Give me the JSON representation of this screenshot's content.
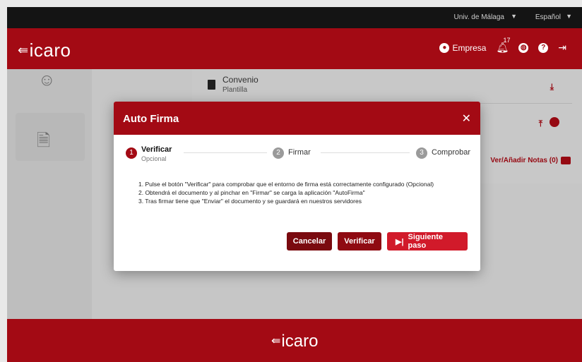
{
  "topbar": {
    "university": "Univ. de Málaga",
    "language": "Español"
  },
  "header": {
    "logo": "icaro",
    "empresa_label": "Empresa",
    "notifications_count": "17"
  },
  "panel": {
    "doc_title": "Convenio",
    "doc_subtitle": "Plantilla",
    "notes_label": "Ver/Añadir Notas (0)"
  },
  "modal": {
    "title": "Auto Firma",
    "steps": [
      {
        "num": "1",
        "label": "Verificar",
        "sub": "Opcional"
      },
      {
        "num": "2",
        "label": "Firmar"
      },
      {
        "num": "3",
        "label": "Comprobar"
      }
    ],
    "instructions": [
      "1. Pulse el botón \"Verificar\" para comprobar que el entorno de firma está correctamente configurado (Opcional)",
      "2. Obtendrá el documento y al pinchar en \"Firmar\" se carga la aplicación \"AutoFirma\"",
      "3. Tras firmar tiene que \"Enviar\" el documento y se guardará en nuestros servidores"
    ],
    "buttons": {
      "cancel": "Cancelar",
      "verify": "Verificar",
      "next": "Siguiente paso"
    }
  },
  "footer": {
    "logo": "icaro"
  },
  "colors": {
    "brand_red": "#a30a14",
    "next_red": "#d11a2a"
  }
}
